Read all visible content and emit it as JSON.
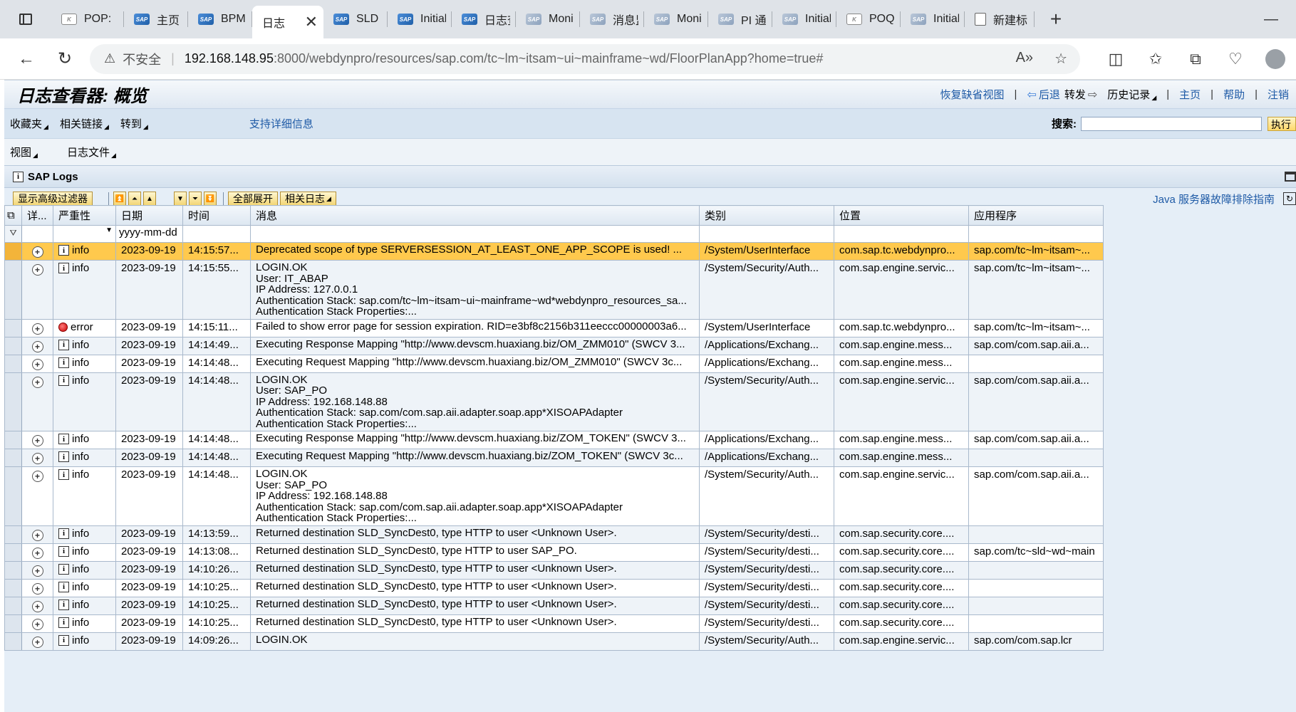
{
  "browser": {
    "tabs": [
      {
        "label": "POP:",
        "icon": "sap-icon-alt"
      },
      {
        "label": "主页",
        "icon": "sap-icon"
      },
      {
        "label": "BPM",
        "icon": "sap-icon"
      },
      {
        "label": "日志",
        "icon": "none",
        "active": true
      },
      {
        "label": "SLD",
        "icon": "sap-icon"
      },
      {
        "label": "Initial",
        "icon": "sap-icon"
      },
      {
        "label": "日志查",
        "icon": "sap-icon"
      },
      {
        "label": "Moni",
        "icon": "sap-icon-grey"
      },
      {
        "label": "消息监",
        "icon": "sap-icon-grey"
      },
      {
        "label": "Moni",
        "icon": "sap-icon-grey"
      },
      {
        "label": "PI 通信",
        "icon": "sap-icon-grey"
      },
      {
        "label": "Initial",
        "icon": "sap-icon-grey"
      },
      {
        "label": "POQ:",
        "icon": "sap-icon-alt"
      },
      {
        "label": "Initial",
        "icon": "sap-icon-grey"
      },
      {
        "label": "新建标",
        "icon": "page-icon"
      }
    ],
    "tab_close": "✕",
    "new_tab": "+",
    "minimize": "—",
    "address": {
      "warning_icon": "⚠",
      "insecure_label": "不安全",
      "separator": "|",
      "host": "192.168.148.95",
      "path": ":8000/webdynpro/resources/sap.com/tc~lm~itsam~ui~mainframe~wd/FloorPlanApp?home=true#"
    }
  },
  "sap": {
    "title": "日志查看器: 概览",
    "top_links": {
      "restore_view": "恢复缺省视图",
      "back": "后退",
      "forward": "转发",
      "history": "历史记录",
      "home": "主页",
      "help": "帮助",
      "logout": "注销",
      "separator": "|"
    },
    "menu": {
      "favorites": "收藏夹",
      "related_links": "相关链接",
      "goto": "转到",
      "support_details": "支持详细信息",
      "search_label": "搜索:",
      "search_value": "",
      "search_go": "执行"
    },
    "submenu": {
      "view": "视图",
      "log_files": "日志文件"
    },
    "panel_title": "SAP Logs",
    "toolbar": {
      "show_filter": "显示高级过滤器",
      "expand_all": "全部展开",
      "related_logs": "相关日志",
      "guide_link": "Java 服务器故障排除指南"
    },
    "table": {
      "columns": [
        "详...",
        "严重性",
        "日期",
        "时间",
        "消息",
        "类别",
        "位置",
        "应用程序"
      ],
      "date_filter": "yyyy-mm-dd",
      "rows": [
        {
          "severity": "info",
          "date": "2023-09-19",
          "time": "14:15:57...",
          "message": [
            "Deprecated scope of type SERVERSESSION_AT_LEAST_ONE_APP_SCOPE is used! ..."
          ],
          "category": "/System/UserInterface",
          "location": "com.sap.tc.webdynpro...",
          "application": "sap.com/tc~lm~itsam~..."
        },
        {
          "severity": "info",
          "date": "2023-09-19",
          "time": "14:15:55...",
          "message": [
            "LOGIN.OK",
            "User: IT_ABAP",
            "IP Address: 127.0.0.1",
            "Authentication Stack: sap.com/tc~lm~itsam~ui~mainframe~wd*webdynpro_resources_sa...",
            "Authentication Stack Properties:..."
          ],
          "category": "/System/Security/Auth...",
          "location": "com.sap.engine.servic...",
          "application": "sap.com/tc~lm~itsam~..."
        },
        {
          "severity": "error",
          "date": "2023-09-19",
          "time": "14:15:11...",
          "message": [
            "Failed to show error page for session expiration. RID=e3bf8c2156b311eeccc00000003a6..."
          ],
          "category": "/System/UserInterface",
          "location": "com.sap.tc.webdynpro...",
          "application": "sap.com/tc~lm~itsam~..."
        },
        {
          "severity": "info",
          "date": "2023-09-19",
          "time": "14:14:49...",
          "message": [
            "Executing Response Mapping \"http://www.devscm.huaxiang.biz/OM_ZMM010\" (SWCV 3..."
          ],
          "category": "/Applications/Exchang...",
          "location": "com.sap.engine.mess...",
          "application": "sap.com/com.sap.aii.a..."
        },
        {
          "severity": "info",
          "date": "2023-09-19",
          "time": "14:14:48...",
          "message": [
            "Executing Request Mapping \"http://www.devscm.huaxiang.biz/OM_ZMM010\" (SWCV 3c..."
          ],
          "category": "/Applications/Exchang...",
          "location": "com.sap.engine.mess...",
          "application": ""
        },
        {
          "severity": "info",
          "date": "2023-09-19",
          "time": "14:14:48...",
          "message": [
            "LOGIN.OK",
            "User: SAP_PO",
            "IP Address: 192.168.148.88",
            "Authentication Stack: sap.com/com.sap.aii.adapter.soap.app*XISOAPAdapter",
            "Authentication Stack Properties:..."
          ],
          "category": "/System/Security/Auth...",
          "location": "com.sap.engine.servic...",
          "application": "sap.com/com.sap.aii.a..."
        },
        {
          "severity": "info",
          "date": "2023-09-19",
          "time": "14:14:48...",
          "message": [
            "Executing Response Mapping \"http://www.devscm.huaxiang.biz/ZOM_TOKEN\" (SWCV 3..."
          ],
          "category": "/Applications/Exchang...",
          "location": "com.sap.engine.mess...",
          "application": "sap.com/com.sap.aii.a..."
        },
        {
          "severity": "info",
          "date": "2023-09-19",
          "time": "14:14:48...",
          "message": [
            "Executing Request Mapping \"http://www.devscm.huaxiang.biz/ZOM_TOKEN\" (SWCV 3c..."
          ],
          "category": "/Applications/Exchang...",
          "location": "com.sap.engine.mess...",
          "application": ""
        },
        {
          "severity": "info",
          "date": "2023-09-19",
          "time": "14:14:48...",
          "message": [
            "LOGIN.OK",
            "User: SAP_PO",
            "IP Address: 192.168.148.88",
            "Authentication Stack: sap.com/com.sap.aii.adapter.soap.app*XISOAPAdapter",
            "Authentication Stack Properties:..."
          ],
          "category": "/System/Security/Auth...",
          "location": "com.sap.engine.servic...",
          "application": "sap.com/com.sap.aii.a..."
        },
        {
          "severity": "info",
          "date": "2023-09-19",
          "time": "14:13:59...",
          "message": [
            "Returned destination SLD_SyncDest0, type HTTP to user <Unknown User>."
          ],
          "category": "/System/Security/desti...",
          "location": "com.sap.security.core....",
          "application": ""
        },
        {
          "severity": "info",
          "date": "2023-09-19",
          "time": "14:13:08...",
          "message": [
            "Returned destination SLD_SyncDest0, type HTTP to user SAP_PO."
          ],
          "category": "/System/Security/desti...",
          "location": "com.sap.security.core....",
          "application": "sap.com/tc~sld~wd~main"
        },
        {
          "severity": "info",
          "date": "2023-09-19",
          "time": "14:10:26...",
          "message": [
            "Returned destination SLD_SyncDest0, type HTTP to user <Unknown User>."
          ],
          "category": "/System/Security/desti...",
          "location": "com.sap.security.core....",
          "application": ""
        },
        {
          "severity": "info",
          "date": "2023-09-19",
          "time": "14:10:25...",
          "message": [
            "Returned destination SLD_SyncDest0, type HTTP to user <Unknown User>."
          ],
          "category": "/System/Security/desti...",
          "location": "com.sap.security.core....",
          "application": ""
        },
        {
          "severity": "info",
          "date": "2023-09-19",
          "time": "14:10:25...",
          "message": [
            "Returned destination SLD_SyncDest0, type HTTP to user <Unknown User>."
          ],
          "category": "/System/Security/desti...",
          "location": "com.sap.security.core....",
          "application": ""
        },
        {
          "severity": "info",
          "date": "2023-09-19",
          "time": "14:10:25...",
          "message": [
            "Returned destination SLD_SyncDest0, type HTTP to user <Unknown User>."
          ],
          "category": "/System/Security/desti...",
          "location": "com.sap.security.core....",
          "application": ""
        },
        {
          "severity": "info",
          "date": "2023-09-19",
          "time": "14:09:26...",
          "message": [
            "LOGIN.OK"
          ],
          "category": "/System/Security/Auth...",
          "location": "com.sap.engine.servic...",
          "application": "sap.com/com.sap.lcr"
        }
      ]
    },
    "colors": {
      "highlight_row": "#ffc94d",
      "link": "#1e5aa6",
      "button": "#f3d676"
    }
  }
}
